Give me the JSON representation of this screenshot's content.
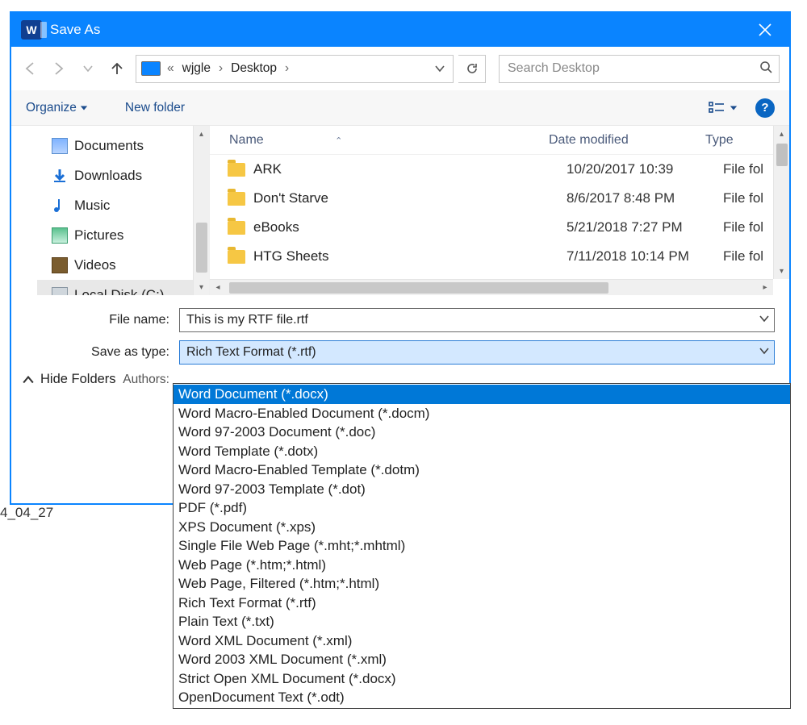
{
  "window": {
    "title": "Save As"
  },
  "under_text": "4_04_27",
  "breadcrumb": {
    "prefix": "«",
    "seg1": "wjgle",
    "seg2": "Desktop"
  },
  "search": {
    "placeholder": "Search Desktop"
  },
  "toolbar": {
    "organize": "Organize",
    "new_folder": "New folder"
  },
  "tree": [
    {
      "icon": "documents-icon",
      "label": "Documents"
    },
    {
      "icon": "downloads-icon",
      "label": "Downloads"
    },
    {
      "icon": "music-icon",
      "label": "Music"
    },
    {
      "icon": "pictures-icon",
      "label": "Pictures"
    },
    {
      "icon": "videos-icon",
      "label": "Videos"
    },
    {
      "icon": "disk-icon",
      "label": "Local Disk (C:)"
    }
  ],
  "columns": {
    "name": "Name",
    "date": "Date modified",
    "type": "Type"
  },
  "rows": [
    {
      "name": "ARK",
      "date": "10/20/2017 10:39",
      "type": "File fol"
    },
    {
      "name": "Don't Starve",
      "date": "8/6/2017 8:48 PM",
      "type": "File fol"
    },
    {
      "name": "eBooks",
      "date": "5/21/2018 7:27 PM",
      "type": "File fol"
    },
    {
      "name": "HTG Sheets",
      "date": "7/11/2018 10:14 PM",
      "type": "File fol"
    }
  ],
  "form": {
    "file_name_label": "File name:",
    "file_name_value": "This is my RTF file.rtf",
    "save_as_type_label": "Save as type:",
    "save_as_type_value": "Rich Text Format (*.rtf)",
    "authors_label": "Authors:"
  },
  "hide_folders": "Hide Folders",
  "dropdown": {
    "highlighted_index": 0,
    "options": [
      "Word Document (*.docx)",
      "Word Macro-Enabled Document (*.docm)",
      "Word 97-2003 Document (*.doc)",
      "Word Template (*.dotx)",
      "Word Macro-Enabled Template (*.dotm)",
      "Word 97-2003 Template (*.dot)",
      "PDF (*.pdf)",
      "XPS Document (*.xps)",
      "Single File Web Page (*.mht;*.mhtml)",
      "Web Page (*.htm;*.html)",
      "Web Page, Filtered (*.htm;*.html)",
      "Rich Text Format (*.rtf)",
      "Plain Text (*.txt)",
      "Word XML Document (*.xml)",
      "Word 2003 XML Document (*.xml)",
      "Strict Open XML Document (*.docx)",
      "OpenDocument Text (*.odt)"
    ]
  }
}
